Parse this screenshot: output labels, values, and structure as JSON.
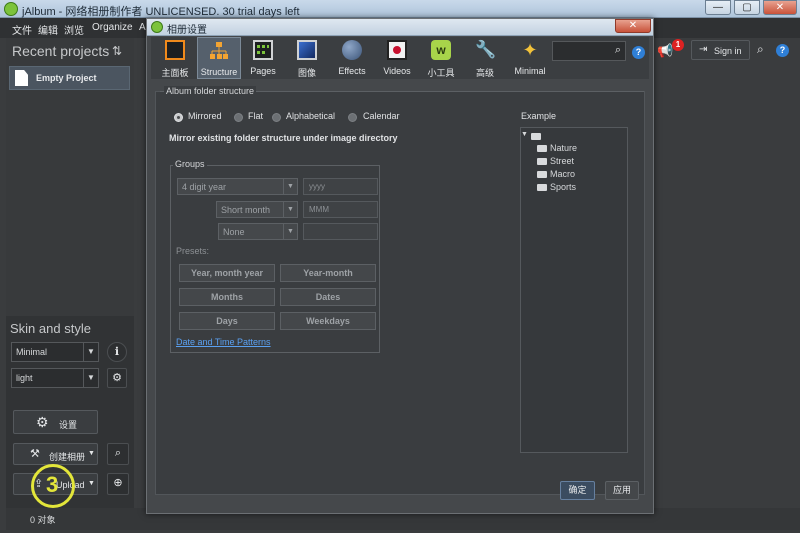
{
  "app": {
    "title": "jAlbum - 网络相册制作者 UNLICENSED. 30 trial days left",
    "menu": [
      "文件",
      "编辑",
      "浏览",
      "Organize",
      "A"
    ]
  },
  "left": {
    "recent_title": "Recent projects",
    "project_item": "Empty Project",
    "skin_title": "Skin and style",
    "skin_value": "Minimal",
    "style_value": "light",
    "settings_btn": "设置",
    "make_btn": "创建相册",
    "upload_btn": "Upload",
    "status": "0 对象",
    "step_marker": "3"
  },
  "right": {
    "sign_in": "Sign in",
    "notify_count": "1"
  },
  "dialog": {
    "title": "相册设置",
    "close": "✕",
    "tabs": [
      {
        "label": "主面板",
        "icon": "main-panel-icon"
      },
      {
        "label": "Structure",
        "icon": "structure-icon"
      },
      {
        "label": "Pages",
        "icon": "pages-icon"
      },
      {
        "label": "图像",
        "icon": "images-icon"
      },
      {
        "label": "Effects",
        "icon": "effects-icon"
      },
      {
        "label": "Videos",
        "icon": "videos-icon"
      },
      {
        "label": "小工具",
        "icon": "widgets-icon"
      },
      {
        "label": "高级",
        "icon": "advanced-icon"
      },
      {
        "label": "Minimal",
        "icon": "minimal-skin-icon"
      }
    ],
    "selected_tab": "Structure",
    "folder_structure": {
      "legend": "Album folder structure",
      "options": [
        "Mirrored",
        "Flat",
        "Alphabetical",
        "Calendar"
      ],
      "selected": "Mirrored",
      "description": "Mirror existing folder structure under image directory"
    },
    "groups": {
      "legend": "Groups",
      "select1": "4 digit year",
      "input1": "yyyy",
      "select2": "Short month",
      "input2": "MMM",
      "select3": "None",
      "presets_label": "Presets:",
      "presets": [
        "Year, month year",
        "Year-month",
        "Months",
        "Dates",
        "Days",
        "Weekdays"
      ],
      "link": "Date and Time Patterns"
    },
    "example": {
      "title": "Example",
      "folders": [
        "Nature",
        "Street",
        "Macro",
        "Sports"
      ]
    },
    "ok": "确定",
    "apply": "应用"
  }
}
